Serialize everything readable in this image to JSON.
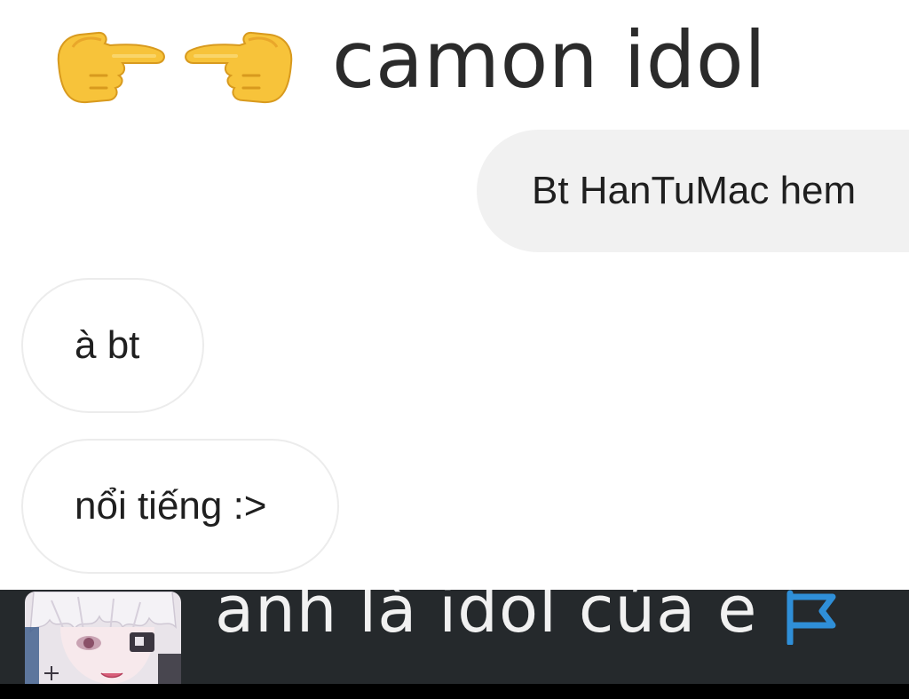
{
  "caption": {
    "emoji": [
      "backhand-index-pointing-right",
      "backhand-index-pointing-left"
    ],
    "text": "camon idol"
  },
  "messages": [
    {
      "direction": "outgoing",
      "text": "Bt HanTuMac hem"
    },
    {
      "direction": "incoming",
      "text": "à bt"
    },
    {
      "direction": "incoming",
      "text": "nổi tiếng :>"
    }
  ],
  "bottom_bar": {
    "avatar_icon": "anime-avatar",
    "text": "anh là idol của e",
    "flag_icon": "flag-icon",
    "flag_color": "#2f8fd8",
    "background_color": "#25292c"
  }
}
